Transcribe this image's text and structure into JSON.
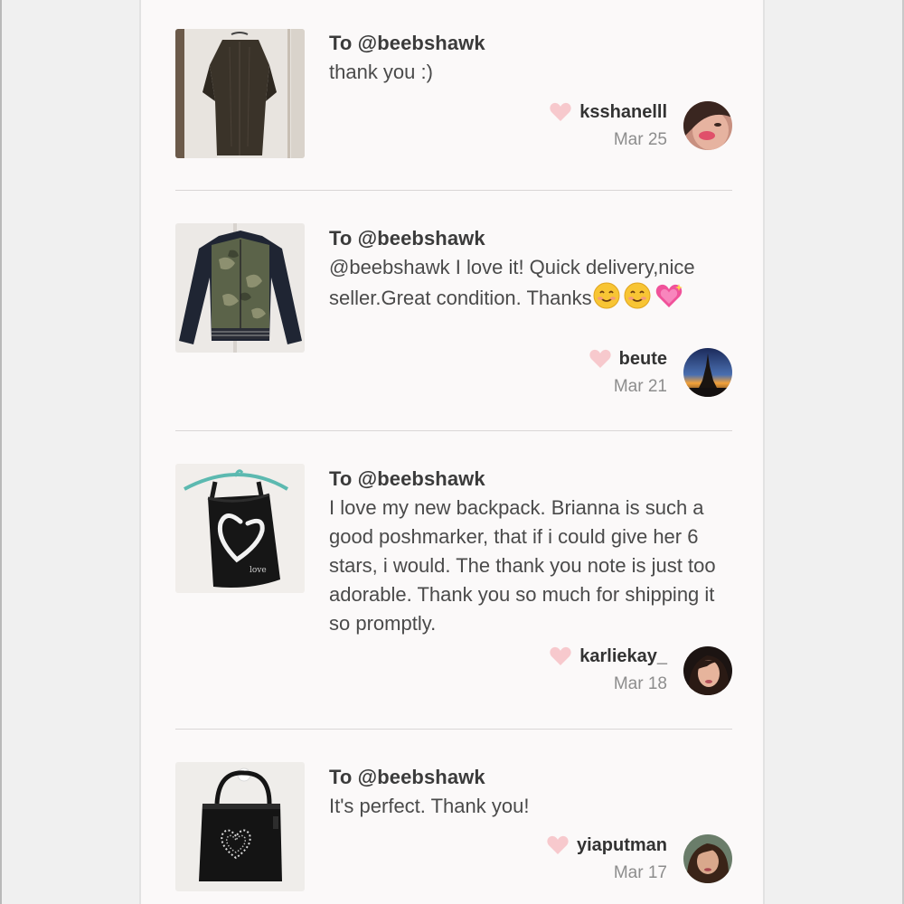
{
  "feed": {
    "items": [
      {
        "to": "To @beebshawk",
        "message": "thank you :)",
        "username": "ksshanelll",
        "date": "Mar 25",
        "item_image": "kimono-cardigan",
        "avatar_image": "avatar-ksshanelll"
      },
      {
        "to": "To @beebshawk",
        "message": "@beebshawk I love it! Quick delivery,nice seller.Great condition. Thanks",
        "emojis": [
          "smiling-face-icon",
          "smiling-face-icon",
          "sparkling-heart-icon"
        ],
        "username": "beute",
        "date": "Mar 21",
        "item_image": "camo-bomber-jacket",
        "avatar_image": "avatar-eiffel-tower"
      },
      {
        "to": "To @beebshawk",
        "message": "I love my new backpack. Brianna is such a good poshmarker, that if i could give her 6 stars, i would. The thank you note is just too adorable. Thank you so much for shipping it so promptly.",
        "username": "karliekay_",
        "date": "Mar 18",
        "item_image": "heart-drawstring-backpack",
        "avatar_image": "avatar-karliekay"
      },
      {
        "to": "To @beebshawk",
        "message": "It's perfect. Thank you!",
        "username": "yiaputman",
        "date": "Mar 17",
        "item_image": "studded-heart-handbag",
        "avatar_image": "avatar-yiaputman"
      }
    ]
  },
  "colors": {
    "heart": "#f7c9cd",
    "divider": "#d9d6d6",
    "background": "#fbf9f9"
  }
}
